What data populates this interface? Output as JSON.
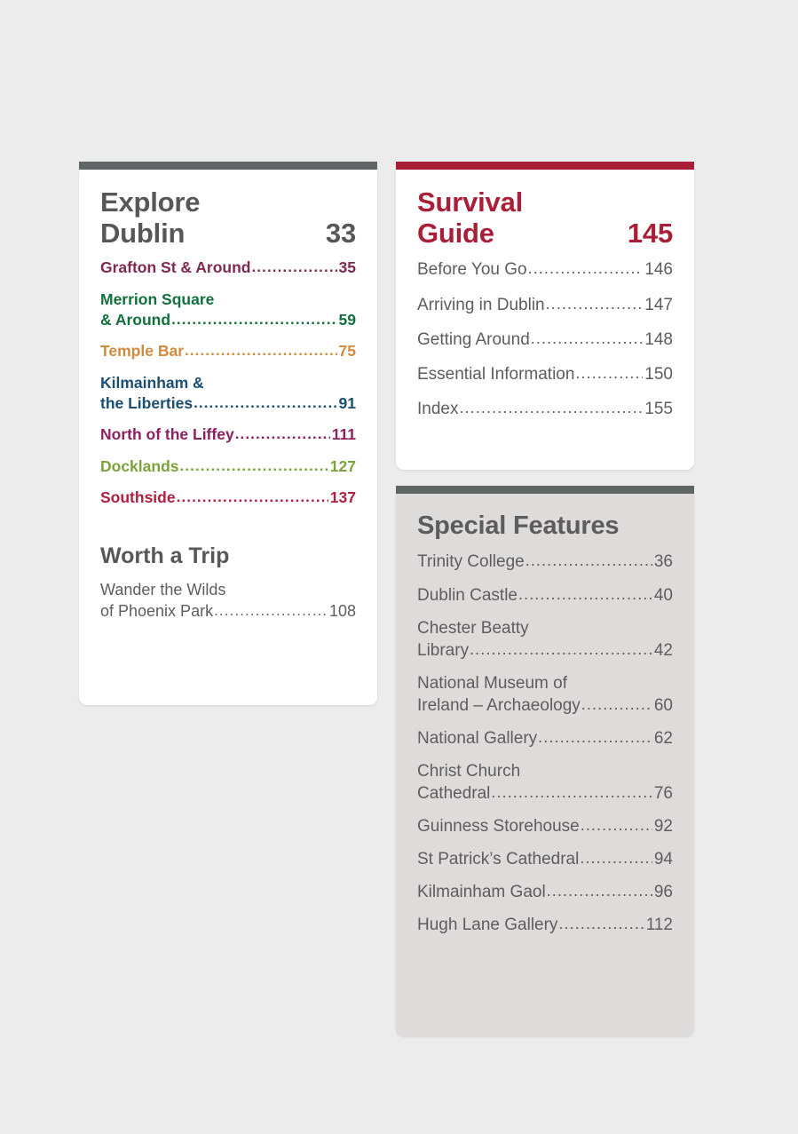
{
  "colors": {
    "page_background": "#ececec",
    "explore_bar": "#5f6564",
    "survival_bar": "#a81f37",
    "special_bar": "#5f6564",
    "card_white": "#ffffff",
    "card_grey": "#dedbdb",
    "heading_grey": "#575757",
    "body_grey": "#5d5d5d"
  },
  "explore": {
    "bar_color": "#5f6564",
    "title_line1": "Explore",
    "title_line2": "Dublin",
    "page": "33",
    "items": [
      {
        "label": "Grafton St & Around",
        "label_line2": "",
        "page": "35",
        "color": "#7c2a52",
        "dots": "......."
      },
      {
        "label": "Merrion Square",
        "label_line2": "& Around",
        "page": "59",
        "color": "#12703c",
        "dots": "........................."
      },
      {
        "label": "Temple Bar",
        "label_line2": "",
        "page": "75",
        "color": "#d18b3f",
        "dots": "........................"
      },
      {
        "label": "Kilmainham &",
        "label_line2": "the Liberties",
        "page": "91",
        "color": "#1a4f72",
        "dots": "...................."
      },
      {
        "label": "North of the Liffey",
        "label_line2": "",
        "page": "111",
        "color": "#8d2060",
        "dots": "..........."
      },
      {
        "label": "Docklands",
        "label_line2": "",
        "page": "127",
        "color": "#7ba33c",
        "dots": "......................."
      },
      {
        "label": "Southside",
        "label_line2": "",
        "page": "137",
        "color": "#b02040",
        "dots": "........................."
      }
    ],
    "worth_a_trip_title": "Worth a Trip",
    "worth_items": [
      {
        "label": "Wander the Wilds",
        "label_line2": "of Phoenix Park",
        "page": "108",
        "color": "#5d5d5d",
        "dots": "............"
      }
    ]
  },
  "survival": {
    "bar_color": "#a81f37",
    "title_line1": "Survival",
    "title_line2": "Guide",
    "page": "145",
    "items": [
      {
        "label": "Before You Go",
        "label_line2": "",
        "page": "146",
        "dots": "................"
      },
      {
        "label": "Arriving in Dublin",
        "label_line2": "",
        "page": "147",
        "dots": "............"
      },
      {
        "label": "Getting Around",
        "label_line2": "",
        "page": "148",
        "dots": ".............."
      },
      {
        "label": "Essential Information",
        "label_line2": "",
        "page": "150",
        "dots": "..."
      },
      {
        "label": "Index",
        "label_line2": "",
        "page": "155",
        "dots": "................................"
      }
    ]
  },
  "special": {
    "bar_color": "#5f6564",
    "title": "Special Features",
    "items": [
      {
        "label": "Trinity College",
        "label_line2": "",
        "page": "36",
        "dots": "................."
      },
      {
        "label": "Dublin Castle",
        "label_line2": "",
        "page": "40",
        "dots": "..................."
      },
      {
        "label": "Chester Beatty",
        "label_line2": "Library",
        "page": "42",
        "dots": "..............................."
      },
      {
        "label": "National Museum of",
        "label_line2": "Ireland – Archaeology",
        "page": "60",
        "dots": "....."
      },
      {
        "label": "National Gallery",
        "label_line2": "",
        "page": "62",
        "dots": "..............."
      },
      {
        "label": "Christ Church",
        "label_line2": "Cathedral",
        "page": "76",
        "dots": "..........................."
      },
      {
        "label": "Guinness Storehouse",
        "label_line2": "",
        "page": "92",
        "dots": "......"
      },
      {
        "label": "St Patrick’s Cathedral",
        "label_line2": "",
        "page": "94",
        "dots": "....."
      },
      {
        "label": "Kilmainham Gaol",
        "label_line2": "",
        "page": "96",
        "dots": ".............."
      },
      {
        "label": "Hugh Lane Gallery",
        "label_line2": "",
        "page": "112",
        "dots": ".........."
      }
    ]
  }
}
